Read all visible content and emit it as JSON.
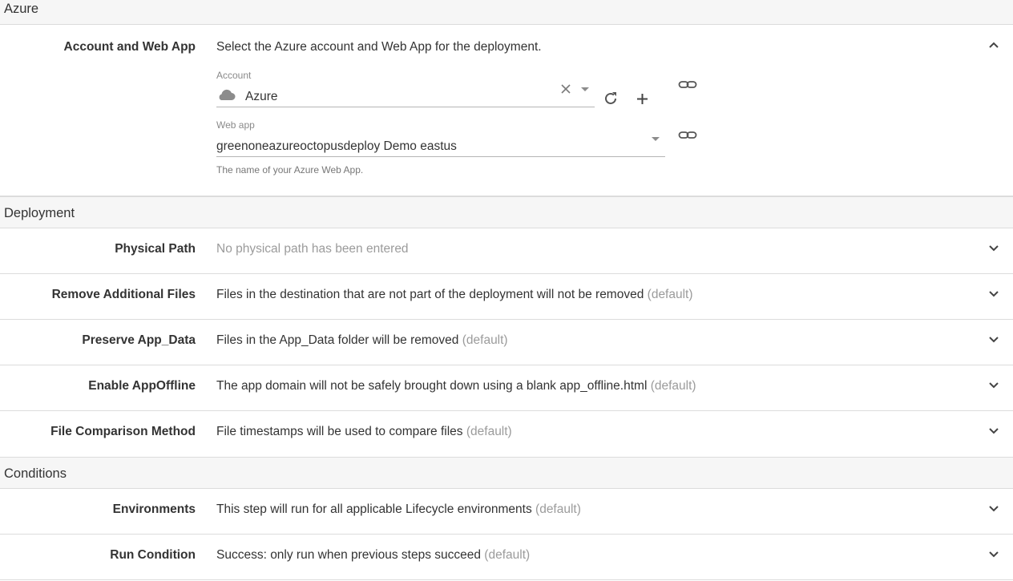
{
  "sections": {
    "azure": "Azure",
    "deployment": "Deployment",
    "conditions": "Conditions"
  },
  "account_web_app": {
    "label": "Account and Web App",
    "summary": "Select the Azure account and Web App for the deployment.",
    "account_label": "Account",
    "account_value": "Azure",
    "webapp_label": "Web app",
    "webapp_value": "greenoneazureoctopusdeploy Demo eastus",
    "webapp_help": "The name of your Azure Web App."
  },
  "deployment_rows": [
    {
      "label": "Physical Path",
      "summary": "No physical path has been entered",
      "suffix": ""
    },
    {
      "label": "Remove Additional Files",
      "summary": "Files in the destination that are not part of the deployment will not be removed",
      "suffix": "(default)"
    },
    {
      "label": "Preserve App_Data",
      "summary": "Files in the App_Data folder will be removed",
      "suffix": "(default)"
    },
    {
      "label": "Enable AppOffline",
      "summary": "The app domain will not be safely brought down using a blank app_offline.html",
      "suffix": "(default)"
    },
    {
      "label": "File Comparison Method",
      "summary": "File timestamps will be used to compare files",
      "suffix": "(default)"
    }
  ],
  "condition_rows": [
    {
      "label": "Environments",
      "summary": "This step will run for all applicable Lifecycle environments",
      "suffix": "(default)"
    },
    {
      "label": "Run Condition",
      "summary": "Success: only run when previous steps succeed",
      "suffix": "(default)"
    }
  ],
  "icons": {
    "collapse": "chevron-up-icon",
    "expand": "chevron-down-icon",
    "cloud": "cloud-icon",
    "clear": "close-icon",
    "dropdown": "caret-down-icon",
    "refresh": "refresh-icon",
    "add": "plus-icon",
    "bind": "link-icon"
  }
}
